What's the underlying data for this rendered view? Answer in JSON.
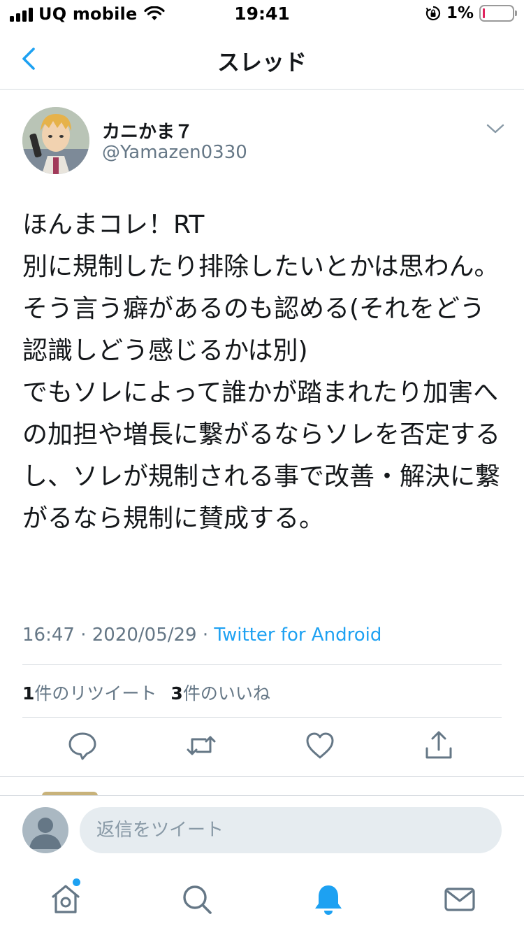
{
  "status_bar": {
    "carrier": "UQ mobile",
    "time": "19:41",
    "battery_percent": "1%",
    "battery_level": 0.01,
    "icons": [
      "signal-icon",
      "wifi-icon",
      "orientation-lock-icon",
      "battery-icon"
    ]
  },
  "header": {
    "title": "スレッド",
    "back_icon": "chevron-left-icon"
  },
  "tweet": {
    "display_name": "カニかま７",
    "handle": "@Yamazen0330",
    "text": "ほんまコレ！RT\n別に規制したり排除したいとかは思わん。そう言う癖があるのも認める(それをどう認識しどう感じるかは別)\nでもソレによって誰かが踏まれたり加害への加担や増長に繋がるならソレを否定するし、ソレが規制される事で改善・解決に繋がるなら規制に賛成する。",
    "time": "16:47",
    "date": "2020/05/29",
    "separator": "·",
    "source": "Twitter for Android",
    "retweet_count": "1",
    "retweet_label": "件のリツイート",
    "like_count": "3",
    "like_label": "件のいいね",
    "actions": [
      "reply-icon",
      "retweet-icon",
      "like-icon",
      "share-icon"
    ]
  },
  "reply_bar": {
    "placeholder": "返信をツイート"
  },
  "tabbar": {
    "items": [
      "home-icon",
      "search-icon",
      "notifications-icon",
      "messages-icon"
    ],
    "active": "notifications-icon",
    "accent": "#1da1f2"
  },
  "colors": {
    "accent": "#1da1f2",
    "secondary_text": "#657786",
    "divider": "#d6dbe0"
  }
}
